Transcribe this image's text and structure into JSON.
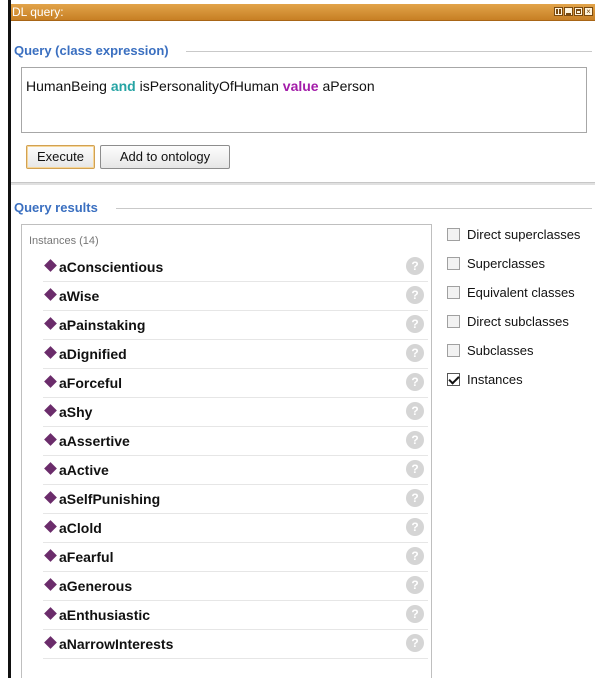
{
  "window": {
    "title": "DL query:"
  },
  "query": {
    "section_title": "Query (class expression)",
    "expression": {
      "part1": "HumanBeing ",
      "kw1": "and",
      "part2": " isPersonalityOfHuman ",
      "kw2": "value",
      "part3": " aPerson"
    },
    "execute_label": "Execute",
    "add_to_ontology_label": "Add to ontology"
  },
  "results": {
    "section_title": "Query results",
    "list_header": "Instances (14)",
    "items": [
      "aConscientious",
      "aWise",
      "aPainstaking",
      "aDignified",
      "aForceful",
      "aShy",
      "aAssertive",
      "aActive",
      "aSelfPunishing",
      "aClold",
      "aFearful",
      "aGenerous",
      "aEnthusiastic",
      "aNarrowInterests"
    ],
    "help_glyph": "?"
  },
  "options": [
    {
      "label": "Direct superclasses",
      "checked": false
    },
    {
      "label": "Superclasses",
      "checked": false
    },
    {
      "label": "Equivalent classes",
      "checked": false
    },
    {
      "label": "Direct subclasses",
      "checked": false
    },
    {
      "label": "Subclasses",
      "checked": false
    },
    {
      "label": "Instances",
      "checked": true
    }
  ],
  "colors": {
    "titlebar": "#d08f35",
    "section_header": "#3a6fc0",
    "keyword_and": "#26a4a4",
    "keyword_value": "#a31ca9",
    "individual_marker": "#6b2c6b"
  }
}
